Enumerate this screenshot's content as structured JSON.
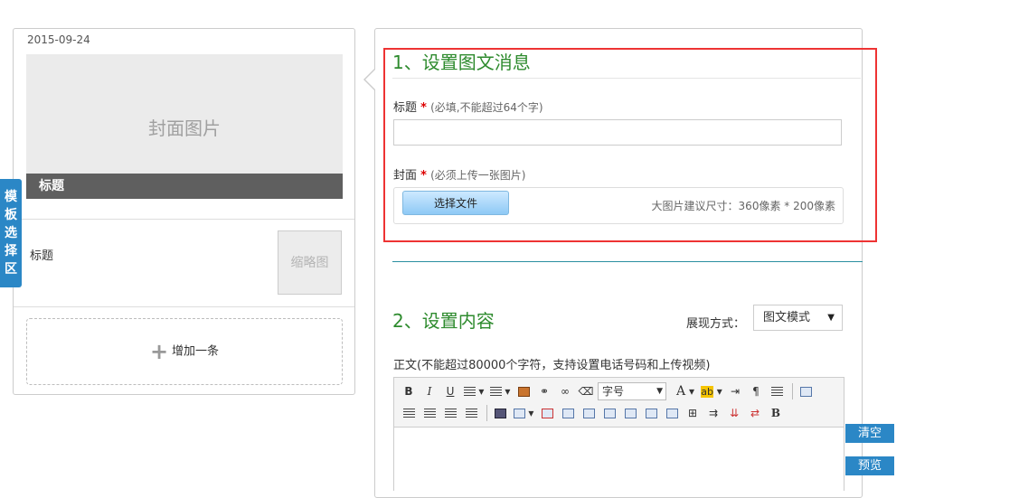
{
  "preview": {
    "date": "2015-09-24",
    "cover_placeholder": "封面图片",
    "cover_title": "标题",
    "item2_title": "标题",
    "thumb_placeholder": "缩略图",
    "add_label": "增加一条"
  },
  "template_tab": [
    "模",
    "板",
    "选",
    "择",
    "区"
  ],
  "section1": {
    "title": "1、设置图文消息",
    "title_label": "标题",
    "title_required": "*",
    "title_hint": "(必填,不能超过64个字)",
    "title_value": "",
    "cover_label": "封面",
    "cover_required": "*",
    "cover_hint": "(必须上传一张图片)",
    "file_button": "选择文件",
    "cover_size_hint": "大图片建议尺寸：360像素 * 200像素"
  },
  "section2": {
    "title": "2、设置内容",
    "mode_label": "展现方式：",
    "mode_value": "图文模式",
    "body_label": "正文(不能超过80000个字符，支持设置电话号码和上传视频)",
    "fontsize_label": "字号"
  },
  "toolbar": {
    "bold": "B",
    "italic": "I",
    "underline": "U",
    "font_color": "A",
    "highlight": "ab",
    "insert_b": "B"
  },
  "side_buttons": {
    "clear": "清空",
    "preview": "预览"
  }
}
